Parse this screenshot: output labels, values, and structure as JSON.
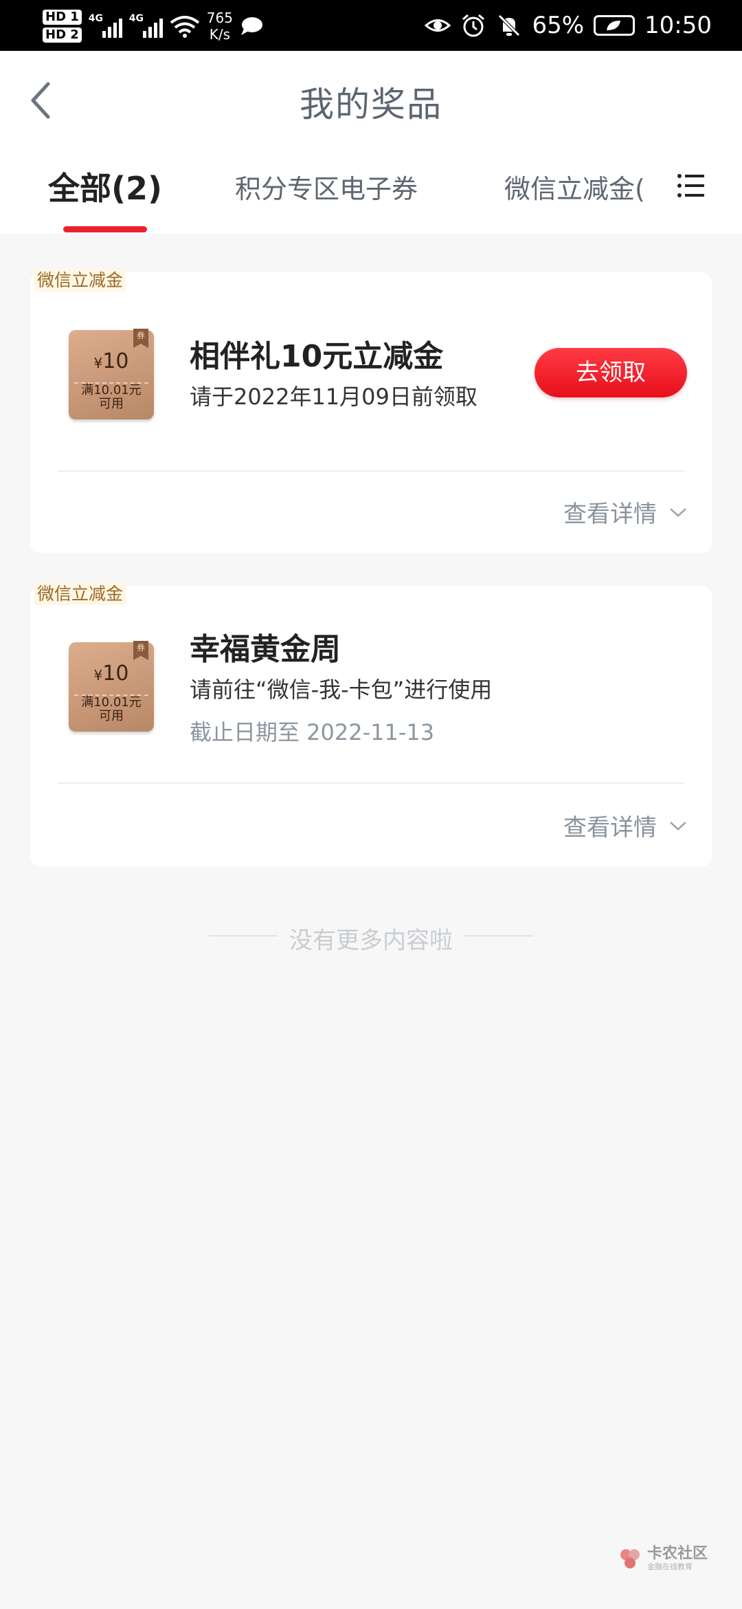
{
  "status_bar": {
    "hd1": "HD 1",
    "hd2": "HD 2",
    "net1": "4G",
    "net2": "4G",
    "speed_value": "765",
    "speed_unit": "K/s",
    "battery": "65%",
    "time": "10:50"
  },
  "header": {
    "title": "我的奖品"
  },
  "tabs": [
    {
      "label": "全部(2)",
      "active": true
    },
    {
      "label": "积分专区电子券",
      "active": false
    },
    {
      "label": "微信立减金(",
      "active": false
    }
  ],
  "prizes": [
    {
      "badge": "微信立减金",
      "coupon_amount": "10",
      "coupon_currency": "¥",
      "coupon_condition_1": "满10.01元",
      "coupon_condition_2": "可用",
      "coupon_flag": "券",
      "title": "相伴礼10元立减金",
      "desc": "请于2022年11月09日前领取",
      "action": "去领取",
      "details": "查看详情"
    },
    {
      "badge": "微信立减金",
      "coupon_amount": "10",
      "coupon_currency": "¥",
      "coupon_condition_1": "满10.01元",
      "coupon_condition_2": "可用",
      "coupon_flag": "券",
      "title": "幸福黄金周",
      "desc": "请前往“微信-我-卡包”进行使用",
      "expiry": "截止日期至 2022-11-13",
      "details": "查看详情"
    }
  ],
  "footer": {
    "end_message": "没有更多内容啦"
  },
  "watermark": {
    "main": "卡农社区",
    "sub": "金融在线教育"
  },
  "colors": {
    "accent": "#e8232f",
    "title": "#5b6570",
    "badge_text": "#9a6a28",
    "coupon": "#c99a78"
  }
}
